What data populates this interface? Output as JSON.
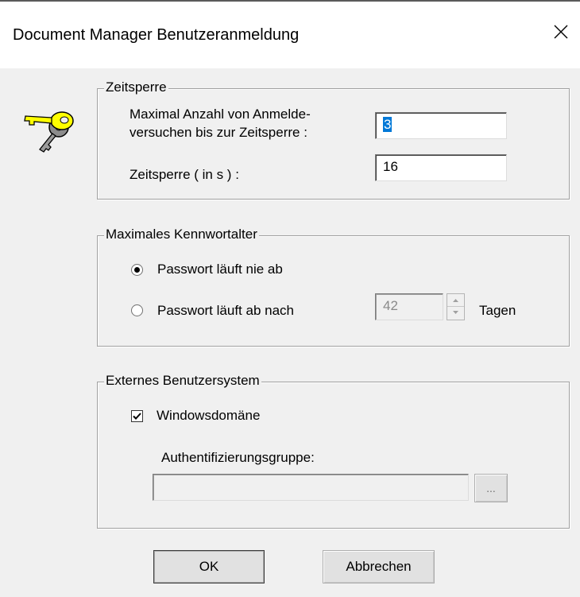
{
  "window": {
    "title": "Document Manager Benutzeranmeldung"
  },
  "timeout_group": {
    "legend": "Zeitsperre",
    "attempts_label_line1": "Maximal Anzahl von Anmelde-",
    "attempts_label_line2": "versuchen bis zur Zeitsperre :",
    "attempts_value": "3",
    "timeout_label": "Zeitsperre ( in s ) :",
    "timeout_value": "16"
  },
  "password_age_group": {
    "legend": "Maximales Kennwortalter",
    "option_never": "Passwort läuft nie ab",
    "option_after": "Passwort läuft ab nach",
    "days_value": "42",
    "days_unit": "Tagen",
    "selected_option": "never"
  },
  "external_group": {
    "legend": "Externes Benutzersystem",
    "windows_domain_label": "Windowsdomäne",
    "windows_domain_checked": true,
    "auth_group_label": "Authentifizierungsgruppe:",
    "auth_group_value": "",
    "browse_label": "..."
  },
  "buttons": {
    "ok": "OK",
    "cancel": "Abbrechen"
  }
}
